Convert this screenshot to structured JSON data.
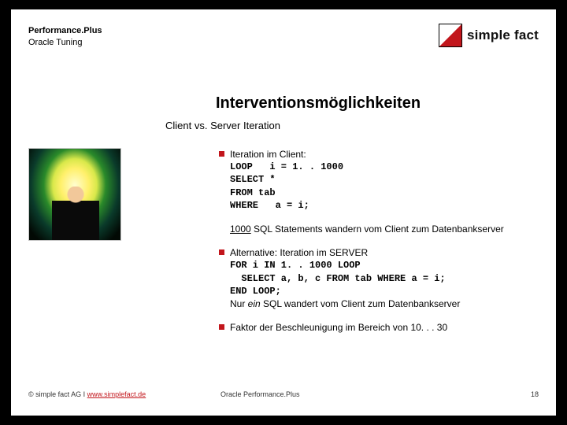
{
  "header": {
    "line1": "Performance.Plus",
    "line2": "Oracle Tuning",
    "logo_text": "simple fact"
  },
  "title": "Interventionsmöglichkeiten",
  "subtitle": "Client vs. Server Iteration",
  "bullets": {
    "b1_lead": "Iteration im Client:",
    "b1_code": "LOOP   i = 1. . 1000\nSELECT *\nFROM tab\nWHERE   a = i;",
    "note_count": "1000",
    "note_rest": " SQL Statements wandern vom Client zum Datenbankserver",
    "b2_lead": "Alternative: Iteration im SERVER",
    "b2_code": "FOR i IN 1. . 1000 LOOP\n  SELECT a, b, c FROM tab WHERE a = i;\nEND LOOP;",
    "b2_tail_pre": "Nur ",
    "b2_tail_em": "ein",
    "b2_tail_post": "  SQL wandert vom Client zum Datenbankserver",
    "b3": "Faktor der Beschleunigung im Bereich von  10. . . 30"
  },
  "footer": {
    "copyright": "© simple fact AG  I  ",
    "link": "www.simplefact.de",
    "center": "Oracle Performance.Plus",
    "page": "18"
  }
}
